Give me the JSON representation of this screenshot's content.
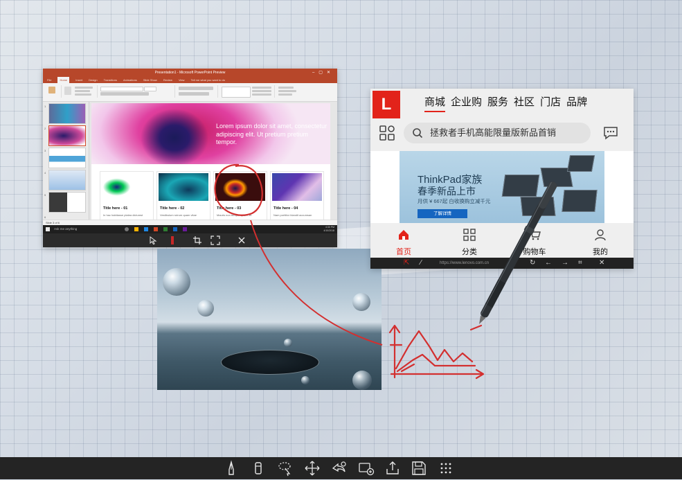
{
  "ppt": {
    "title": "Presentation1 - Microsoft PowerPoint Preview",
    "tabs": [
      "File",
      "Home",
      "Insert",
      "Design",
      "Transitions",
      "Animations",
      "Slide Show",
      "Review",
      "View",
      "Tell me what you want to do"
    ],
    "active_tab": "Home",
    "hero_text": "Lorem ipsum dolor sit amet, consectetur adipiscing elit. Ut pretium pretium tempor.",
    "cards": [
      {
        "title": "Title here - 01",
        "text": "In hac habitasse platea dictumst"
      },
      {
        "title": "Title here - 02",
        "text": "Vestibulum rutrum quam vitae"
      },
      {
        "title": "Title here - 03",
        "text": "Mauris non tempor quam, et"
      },
      {
        "title": "Title here - 04",
        "text": "Nam porttitor blandit accumsan"
      }
    ],
    "thumb_numbers": [
      "1",
      "2",
      "3",
      "4",
      "5",
      "6"
    ],
    "status": "Slide 3 of 6",
    "taskbar_search": "Ask me anything",
    "clock_time": "4:30 PM",
    "clock_date": "4/10/2018"
  },
  "lenovo": {
    "logo": "L",
    "nav": [
      "商城",
      "企业购",
      "服务",
      "社区",
      "门店",
      "品牌"
    ],
    "search_placeholder": "拯救者手机高能限量版新品首销",
    "banner_line1": "ThinkPad家族",
    "banner_line2": "春季新品上市",
    "banner_line3": "月供 ¥ 667起 白收换购立减千元",
    "banner_button": "了解详情",
    "tabs": [
      "首页",
      "分类",
      "购物车",
      "我的"
    ],
    "active_tab": "首页",
    "url": "https://www.lenovo.com.cn"
  },
  "colors": {
    "ppt_accent": "#b7472a",
    "lenovo_red": "#e2231a",
    "ink_red": "#d32f2f",
    "toolbar_dark": "#242424"
  },
  "bottom_toolbar": [
    "pen-icon",
    "eraser-icon",
    "lasso-select-icon",
    "move-icon",
    "undo-icon",
    "add-image-icon",
    "share-icon",
    "save-icon",
    "more-grid-icon"
  ]
}
